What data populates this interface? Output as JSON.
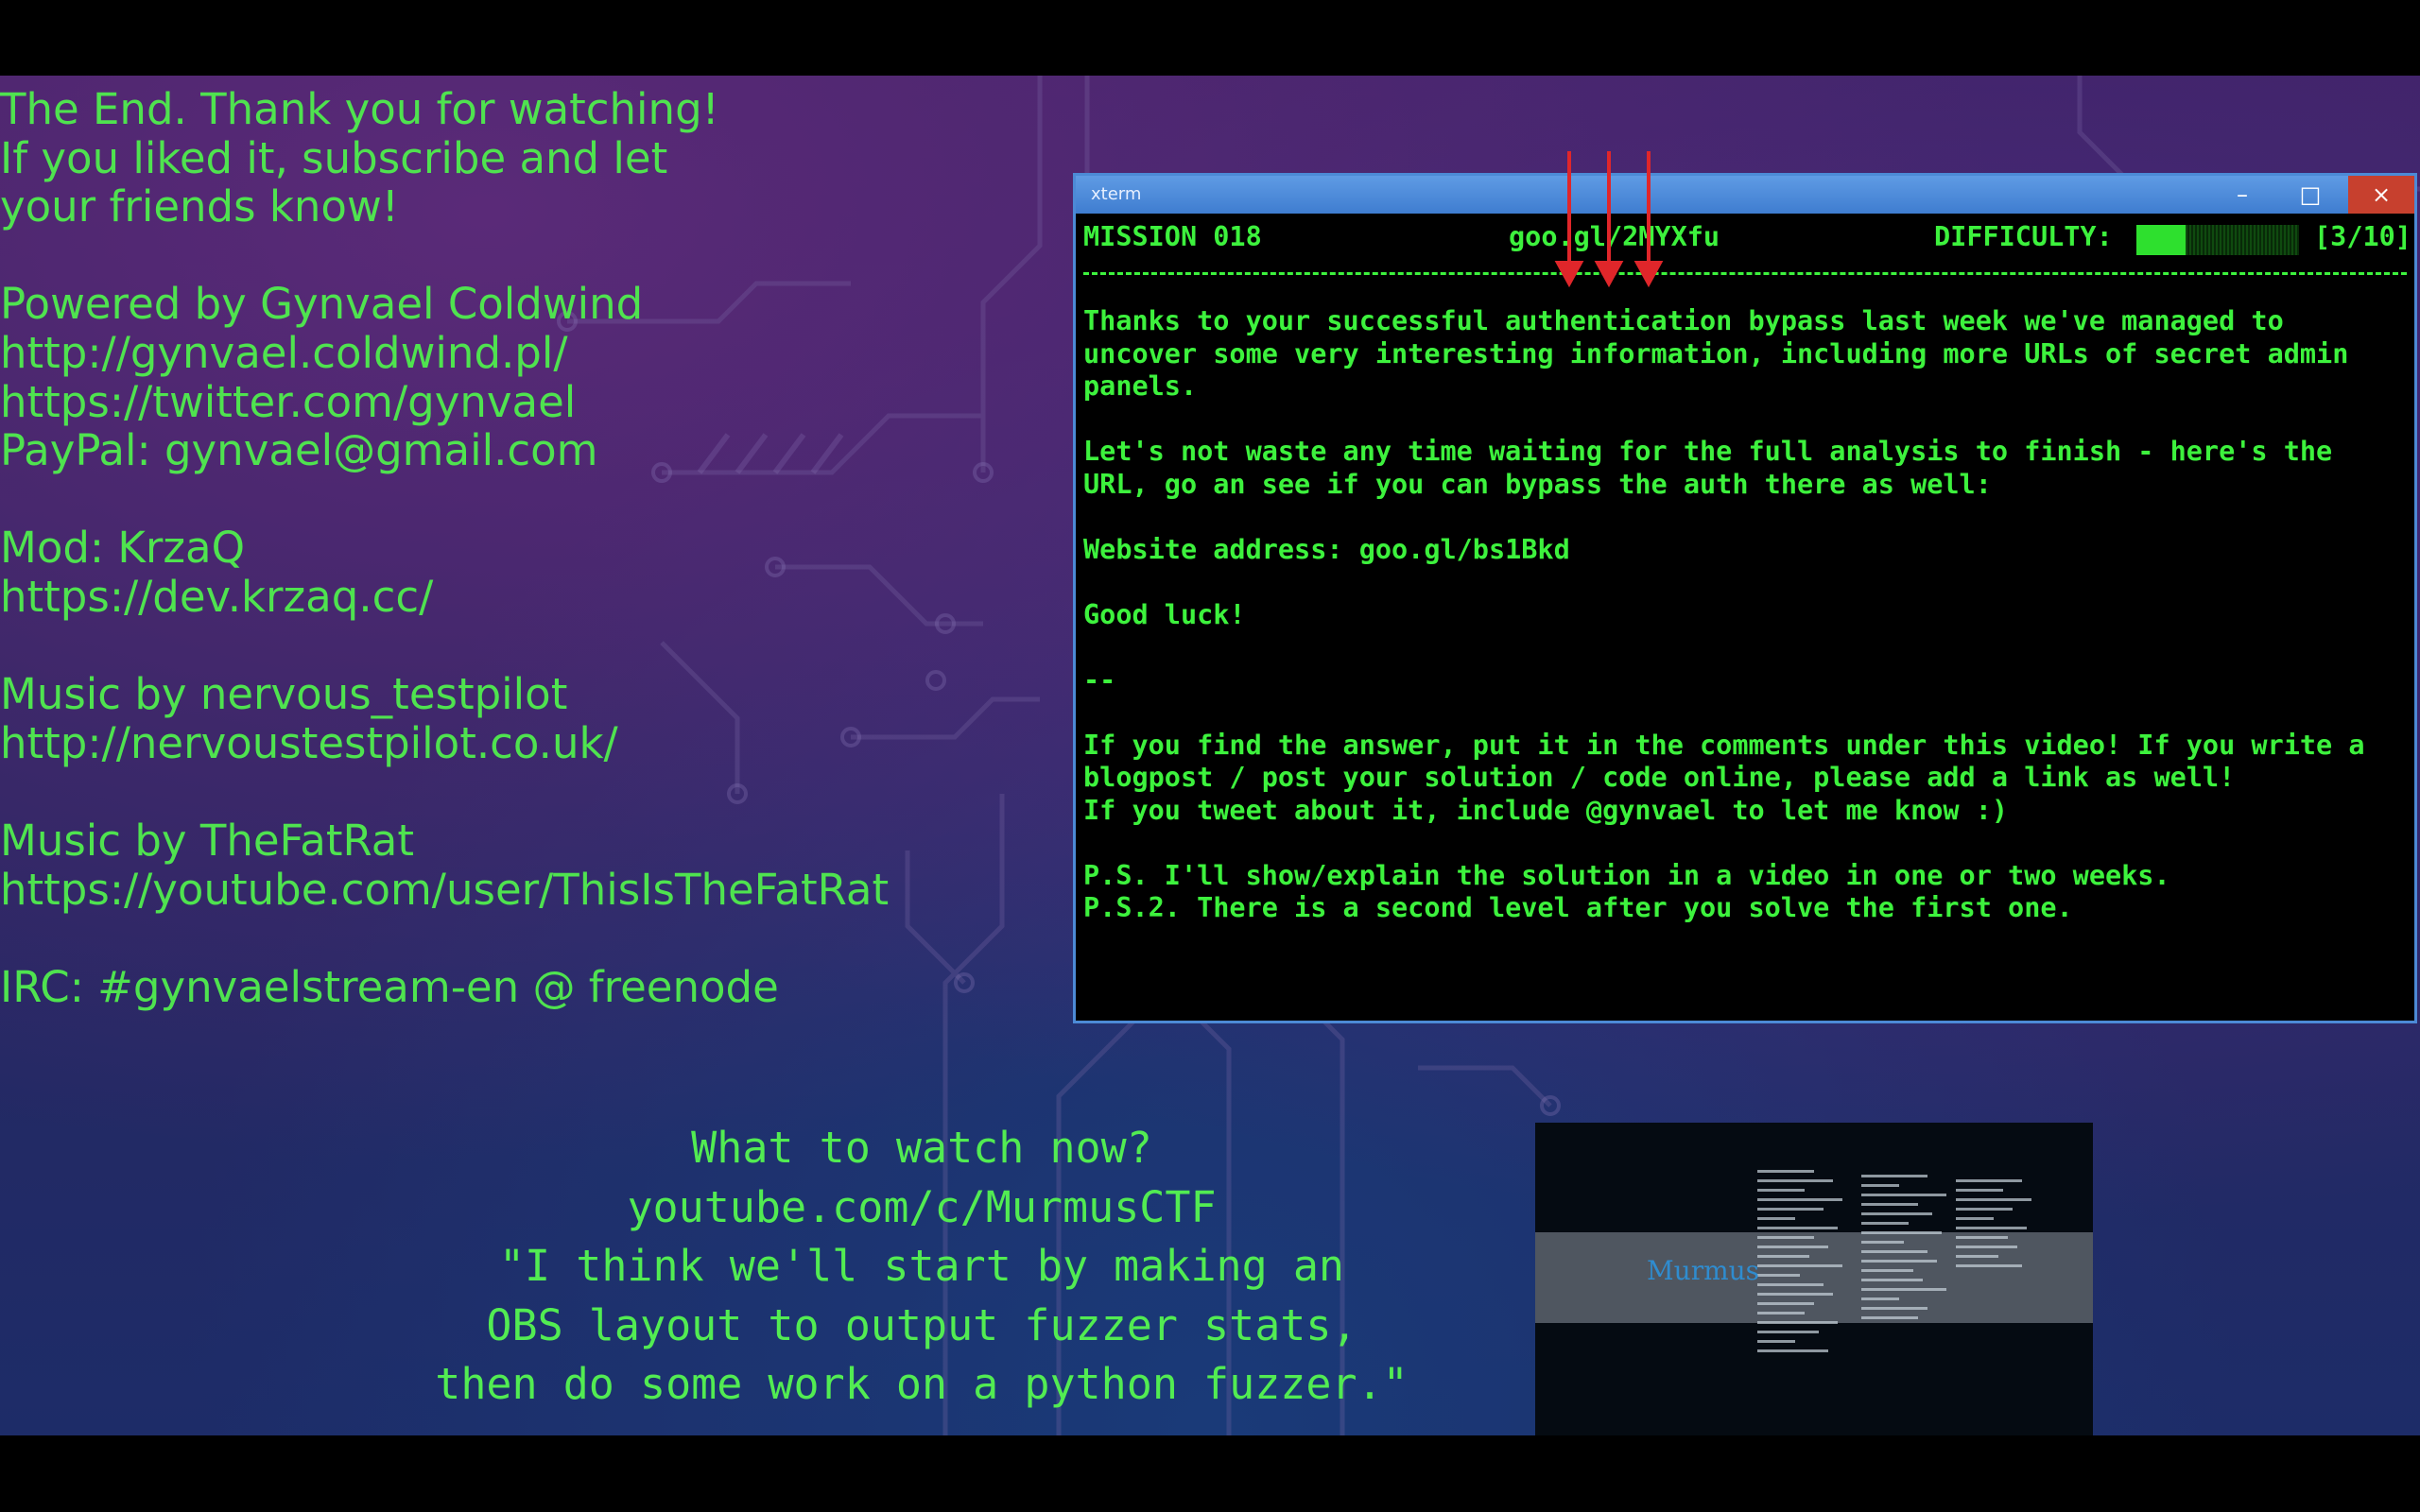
{
  "credits": [
    "The End. Thank you for watching!",
    "If you liked it, subscribe and let",
    "your friends know!",
    "",
    "Powered by Gynvael Coldwind",
    "http://gynvael.coldwind.pl/",
    "https://twitter.com/gynvael",
    "PayPal: gynvael@gmail.com",
    "",
    "Mod: KrzaQ",
    "https://dev.krzaq.cc/",
    "",
    "Music by nervous_testpilot",
    "http://nervoustestpilot.co.uk/",
    "",
    "Music by TheFatRat",
    "https://youtube.com/user/ThisIsTheFatRat",
    "",
    "IRC: #gynvaelstream-en @ freenode"
  ],
  "xterm": {
    "title": "xterm",
    "buttons": {
      "minimize": "–",
      "maximize": "□",
      "close": "×"
    },
    "header": {
      "mission": "MISSION 018",
      "url": "goo.gl/2MYXfu",
      "difficulty_label": "DIFFICULTY:",
      "difficulty_level": 3,
      "difficulty_max": 10,
      "difficulty_text": "[3/10]"
    },
    "body": [
      "Thanks to your successful authentication bypass last week we've managed to",
      "uncover some very interesting information, including more URLs of secret admin",
      "panels.",
      "",
      "Let's not waste any time waiting for the full analysis to finish - here's the",
      "URL, go an see if you can bypass the auth there as well:",
      "",
      "Website address: goo.gl/bs1Bkd",
      "",
      "Good luck!",
      "",
      "--",
      "",
      "If you find the answer, put it in the comments under this video! If you write a",
      "blogpost / post your solution / code online, please add a link as well!",
      "If you tweet about it, include @gynvael to let me know :)",
      "",
      "P.S. I'll show/explain the solution in a video in one or two weeks.",
      "P.S.2. There is a second level after you solve the first one."
    ]
  },
  "watch_next": [
    "What to watch now?",
    "youtube.com/c/MurmusCTF",
    "\"I think we'll start by making an",
    "OBS layout to output fuzzer stats,",
    "then do some work on a python fuzzer.\""
  ],
  "thumbnail": {
    "logo": "Murmus"
  },
  "colors": {
    "accent_green": "#4fe34f",
    "terminal_green": "#3df23d",
    "titlebar_blue": "#4c8ad6",
    "close_red": "#c7402e"
  }
}
